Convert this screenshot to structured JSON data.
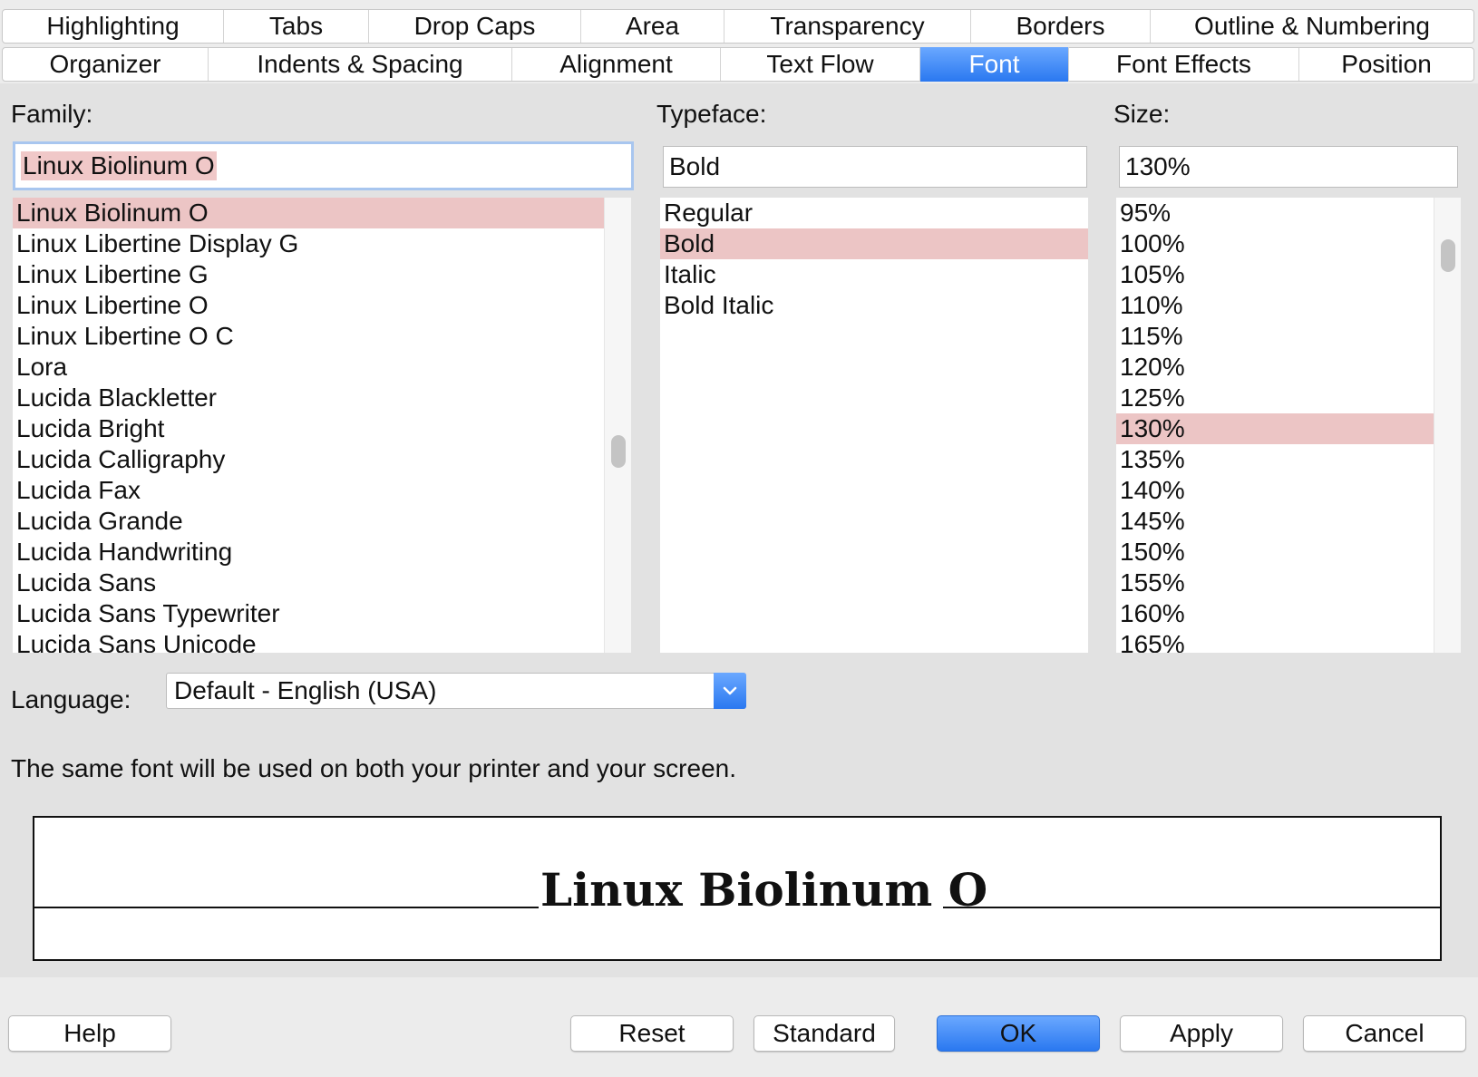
{
  "tabs_row1": [
    "Highlighting",
    "Tabs",
    "Drop Caps",
    "Area",
    "Transparency",
    "Borders",
    "Outline & Numbering"
  ],
  "tabs_row2": [
    "Organizer",
    "Indents & Spacing",
    "Alignment",
    "Text Flow",
    "Font",
    "Font Effects",
    "Position"
  ],
  "active_tab": "Font",
  "family": {
    "label": "Family:",
    "value": "Linux Biolinum O",
    "items": [
      "Linux Biolinum O",
      "Linux Libertine Display G",
      "Linux Libertine G",
      "Linux Libertine O",
      "Linux Libertine O C",
      "Lora",
      "Lucida Blackletter",
      "Lucida Bright",
      "Lucida Calligraphy",
      "Lucida Fax",
      "Lucida Grande",
      "Lucida Handwriting",
      "Lucida Sans",
      "Lucida Sans Typewriter",
      "Lucida Sans Unicode"
    ],
    "selected": "Linux Biolinum O"
  },
  "typeface": {
    "label": "Typeface:",
    "value": "Bold",
    "items": [
      "Regular",
      "Bold",
      "Italic",
      "Bold Italic"
    ],
    "selected": "Bold"
  },
  "size": {
    "label": "Size:",
    "value": "130%",
    "items": [
      "95%",
      "100%",
      "105%",
      "110%",
      "115%",
      "120%",
      "125%",
      "130%",
      "135%",
      "140%",
      "145%",
      "150%",
      "155%",
      "160%",
      "165%"
    ],
    "selected": "130%"
  },
  "language": {
    "label": "Language:",
    "value": "Default - English (USA)"
  },
  "note": "The same font will be used on both your printer and your screen.",
  "preview_text": "Linux Biolinum O",
  "buttons": {
    "help": "Help",
    "reset": "Reset",
    "standard": "Standard",
    "ok": "OK",
    "apply": "Apply",
    "cancel": "Cancel"
  },
  "colors": {
    "accent": "#2a78f0",
    "selection": "#ecc5c5"
  }
}
